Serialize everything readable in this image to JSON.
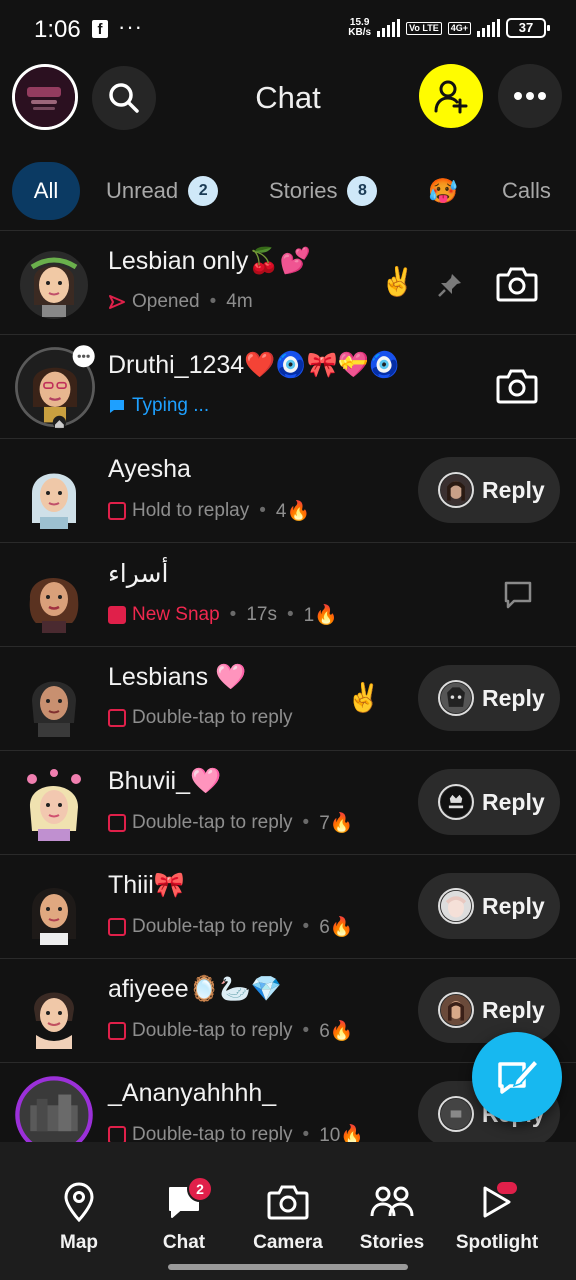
{
  "status_bar": {
    "time": "1:06",
    "speed_top": "15.9",
    "speed_bottom": "KB/s",
    "net_tag1": "Vo LTE",
    "net_tag2": "4G+",
    "battery": "37"
  },
  "header": {
    "title": "Chat"
  },
  "tabs": [
    {
      "label": "All",
      "active": true
    },
    {
      "label": "Unread",
      "badge": "2"
    },
    {
      "label": "Stories",
      "badge": "8"
    },
    {
      "label": "🥵"
    },
    {
      "label": "Calls"
    }
  ],
  "chats": [
    {
      "name": "Lesbian only🍒💕",
      "status": "Opened",
      "time": "4m",
      "emoji": "✌️",
      "pinned": true,
      "action": "camera"
    },
    {
      "name": "Druthi_1234❤️🧿🎀💝🧿",
      "status": "Typing ...",
      "action": "camera"
    },
    {
      "name": "Ayesha",
      "status": "Hold to replay",
      "streak": "4🔥",
      "action": "reply"
    },
    {
      "name": "أسراء",
      "status": "New Snap",
      "time": "17s",
      "streak": "1🔥",
      "action": "chat"
    },
    {
      "name": "Lesbians 🩷",
      "status": "Double-tap to reply",
      "emoji": "✌️",
      "action": "reply"
    },
    {
      "name": "Bhuvii_🩷",
      "status": "Double-tap to reply",
      "streak": "7🔥",
      "action": "reply"
    },
    {
      "name": "Thiii🎀",
      "status": "Double-tap to reply",
      "streak": "6🔥",
      "action": "reply"
    },
    {
      "name": "afiyeee🪞🦢💎",
      "status": "Double-tap to reply",
      "streak": "6🔥",
      "action": "reply"
    },
    {
      "name": "_Ananyahhhh_",
      "status": "Double-tap to reply",
      "streak": "10🔥",
      "action": "reply"
    }
  ],
  "reply_label": "Reply",
  "bottom_nav": [
    {
      "label": "Map",
      "icon": "map-pin-icon"
    },
    {
      "label": "Chat",
      "icon": "chat-icon",
      "badge": "2"
    },
    {
      "label": "Camera",
      "icon": "camera-icon"
    },
    {
      "label": "Stories",
      "icon": "stories-icon"
    },
    {
      "label": "Spotlight",
      "icon": "spotlight-icon"
    }
  ]
}
